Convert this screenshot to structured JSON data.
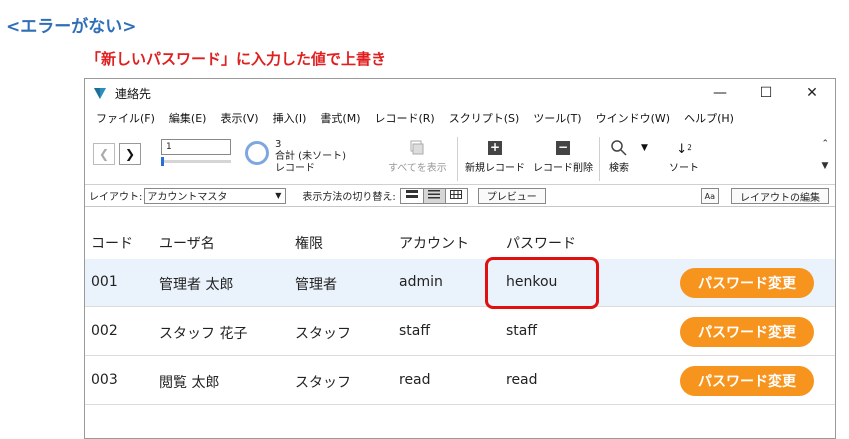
{
  "heading": "<エラーがない>",
  "subheading": "「新しいパスワード」に入力した値で上書き",
  "window": {
    "title": "連絡先",
    "controls": {
      "minimize": "—",
      "maximize": "☐",
      "close": "✕"
    }
  },
  "menu": [
    "ファイル(F)",
    "編集(E)",
    "表示(V)",
    "挿入(I)",
    "書式(M)",
    "レコード(R)",
    "スクリプト(S)",
    "ツール(T)",
    "ウインドウ(W)",
    "ヘルプ(H)"
  ],
  "toolbar": {
    "record_value": "1",
    "record_count": "3",
    "record_status": "合計 (未ソート)",
    "record_unit": "レコード",
    "show_all": "すべてを表示",
    "new_record": "新規レコード",
    "delete_record": "レコード削除",
    "search": "検索",
    "sort": "ソート"
  },
  "layoutbar": {
    "label": "レイアウト:",
    "layout_name": "アカウントマスタ",
    "view_as": "表示方法の切り替え:",
    "preview": "プレビュー",
    "aa": "Aa",
    "edit_layout": "レイアウトの編集"
  },
  "table": {
    "headers": [
      "コード",
      "ユーザ名",
      "権限",
      "アカウント",
      "パスワード"
    ],
    "rows": [
      {
        "code": "001",
        "user": "管理者 太郎",
        "role": "管理者",
        "account": "admin",
        "password": "henkou"
      },
      {
        "code": "002",
        "user": "スタッフ 花子",
        "role": "スタッフ",
        "account": "staff",
        "password": "staff"
      },
      {
        "code": "003",
        "user": "閲覧 太郎",
        "role": "スタッフ",
        "account": "read",
        "password": "read"
      }
    ],
    "button_label": "パスワード変更"
  },
  "colors": {
    "accent_orange": "#f7941d",
    "highlight_red": "#e01010",
    "heading_blue": "#2f6fb7",
    "selected_row": "#eaf2fb"
  }
}
